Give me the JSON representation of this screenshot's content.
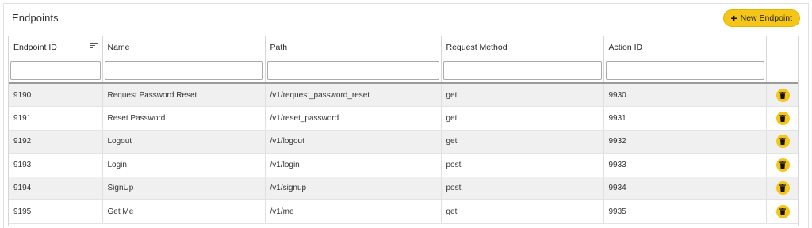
{
  "panel": {
    "title": "Endpoints",
    "new_button_label": "New Endpoint",
    "accent_color": "#f5c518"
  },
  "table": {
    "columns": [
      "Endpoint ID",
      "Name",
      "Path",
      "Request Method",
      "Action ID",
      ""
    ],
    "sort_icon": "sort-ascending-icon",
    "filters": [
      "",
      "",
      "",
      "",
      ""
    ],
    "rows": [
      {
        "id": "9190",
        "name": "Request Password Reset",
        "path": "/v1/request_password_reset",
        "method": "get",
        "action_id": "9930"
      },
      {
        "id": "9191",
        "name": "Reset Password",
        "path": "/v1/reset_password",
        "method": "get",
        "action_id": "9931"
      },
      {
        "id": "9192",
        "name": "Logout",
        "path": "/v1/logout",
        "method": "get",
        "action_id": "9932"
      },
      {
        "id": "9193",
        "name": "Login",
        "path": "/v1/login",
        "method": "post",
        "action_id": "9933"
      },
      {
        "id": "9194",
        "name": "SignUp",
        "path": "/v1/signup",
        "method": "post",
        "action_id": "9934"
      },
      {
        "id": "9195",
        "name": "Get Me",
        "path": "/v1/me",
        "method": "get",
        "action_id": "9935"
      }
    ],
    "row_action_icon": "trash-icon"
  }
}
